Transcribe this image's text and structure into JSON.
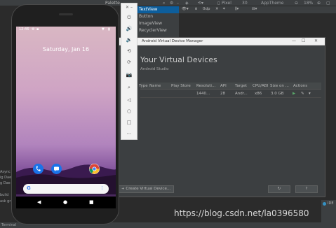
{
  "ide": {
    "palette_title": "Palette",
    "palette_items": [
      "TextView",
      "Button",
      "ImageView",
      "RecyclerView"
    ],
    "toolbar": {
      "device": "Pixel",
      "api": "30",
      "theme": "AppTheme",
      "zoom": "18%",
      "odp": "0dp"
    },
    "left_text": [
      "Async",
      "ig Dae",
      "g Dae",
      "build",
      "ask gr"
    ],
    "bottom": {
      "terminal": "Terminal"
    },
    "notif_label": "IDE"
  },
  "emulator_toolbar": [
    "power-icon",
    "volume-up-icon",
    "volume-down-icon",
    "rotate-left-icon",
    "rotate-right-icon",
    "camera-icon",
    "zoom-icon",
    "back-icon",
    "home-icon",
    "overview-icon",
    "more-icon"
  ],
  "phone": {
    "time": "12:46",
    "date": "Saturday, Jan 16",
    "nav": {
      "back": "◀",
      "home": "●",
      "recents": "■"
    }
  },
  "avd": {
    "window_title": "Android Virtual Device Manager",
    "heading": "Your Virtual Devices",
    "subheading": "Android Studio",
    "columns": [
      "Type",
      "Name",
      "Play Store",
      "Resoluti...",
      "API",
      "Target",
      "CPU/ABI",
      "Size on ...",
      "Actions"
    ],
    "row": {
      "resolution": "1440...",
      "api": "28",
      "target": "Andr...",
      "cpu": "x86",
      "size": "3.0 GB"
    },
    "create_button": "+ Create Virtual Device...",
    "refresh_icon": "refresh-icon",
    "help_button": "?"
  },
  "watermark": "https://blog.csdn.net/la0396580"
}
